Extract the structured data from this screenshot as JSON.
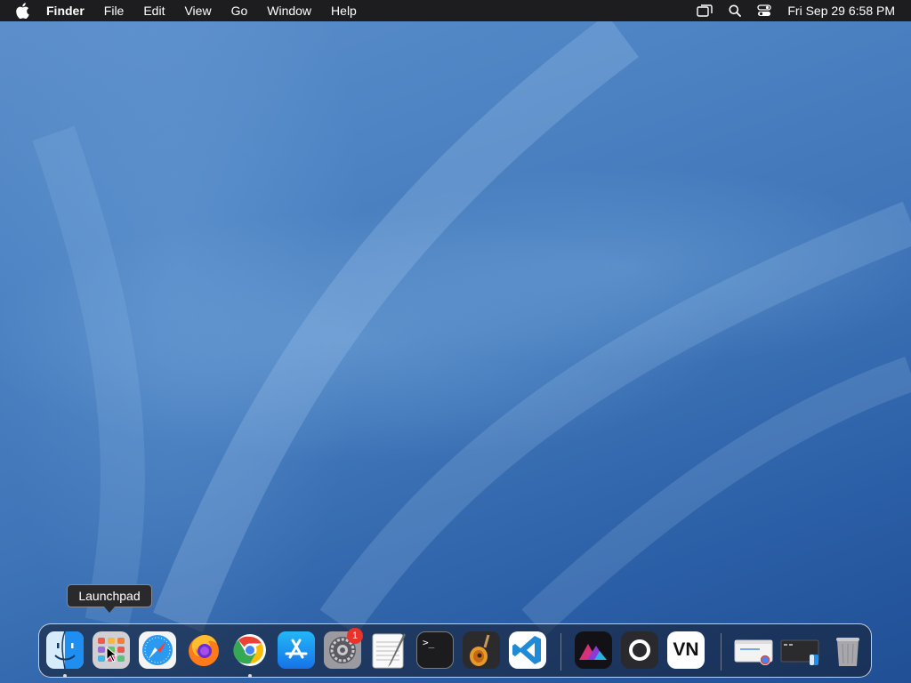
{
  "menubar": {
    "app_name": "Finder",
    "menus": [
      "File",
      "Edit",
      "View",
      "Go",
      "Window",
      "Help"
    ],
    "clock": "Fri Sep 29  6:58 PM",
    "status_icons": [
      "screen-mirroring-icon",
      "spotlight-search-icon",
      "control-center-icon"
    ]
  },
  "tooltip": {
    "label": "Launchpad"
  },
  "dock": {
    "apps": [
      {
        "name": "Finder",
        "running": true
      },
      {
        "name": "Launchpad",
        "running": false
      },
      {
        "name": "Safari",
        "running": false
      },
      {
        "name": "Firefox",
        "running": false
      },
      {
        "name": "Google Chrome",
        "running": true
      },
      {
        "name": "App Store",
        "running": false
      },
      {
        "name": "System Settings",
        "running": false,
        "badge": "1"
      },
      {
        "name": "TextEdit",
        "running": false
      },
      {
        "name": "Terminal",
        "running": false
      },
      {
        "name": "GarageBand",
        "running": false
      },
      {
        "name": "Visual Studio Code",
        "running": false
      },
      {
        "name": "Affinity",
        "running": false
      },
      {
        "name": "OBS",
        "running": false
      },
      {
        "name": "VN",
        "running": false
      }
    ],
    "vn_label": "VN",
    "terminal_prompt": ">_",
    "minimized": [
      "Chrome window",
      "Finder window"
    ],
    "trash": "Trash"
  }
}
